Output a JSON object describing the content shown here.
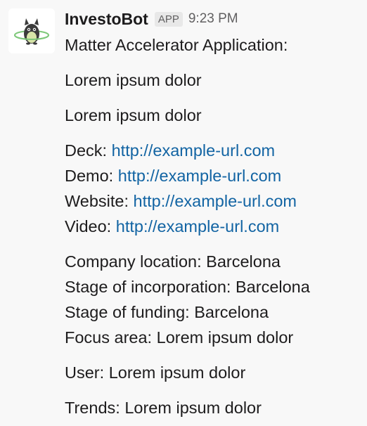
{
  "message": {
    "sender": "InvestoBot",
    "badge": "APP",
    "timestamp": "9:23 PM",
    "avatar_icon": "monster-bot-icon",
    "title": "Matter Accelerator Application:",
    "paragraph_1": "Lorem ipsum dolor",
    "paragraph_2": "Lorem ipsum dolor",
    "links": [
      {
        "label": "Deck:",
        "url": "http://example-url.com"
      },
      {
        "label": "Demo:",
        "url": "http://example-url.com"
      },
      {
        "label": "Website:",
        "url": "http://example-url.com"
      },
      {
        "label": "Video:",
        "url": "http://example-url.com"
      }
    ],
    "details": [
      {
        "label": "Company location:",
        "value": "Barcelona"
      },
      {
        "label": "Stage of incorporation:",
        "value": "Barcelona"
      },
      {
        "label": "Stage of funding:",
        "value": "Barcelona"
      },
      {
        "label": "Focus area:",
        "value": "Lorem ipsum dolor"
      }
    ],
    "user": {
      "label": "User:",
      "value": "Lorem ipsum dolor"
    },
    "trends": {
      "label": "Trends:",
      "value": "Lorem ipsum dolor"
    }
  },
  "colors": {
    "link": "#1264a3",
    "text": "#1d1c1d",
    "muted": "#616061",
    "background": "#f8f8f8"
  }
}
